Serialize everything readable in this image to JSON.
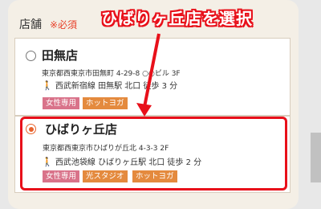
{
  "form": {
    "section_title": "店舗",
    "required_label": "※必須"
  },
  "stores": [
    {
      "name": "田無店",
      "address": "東京都西東京市田無町 4-29-8 ○○ビル 3F",
      "access": "西武新宿線 田無駅 北口 徒歩 3 分",
      "tags": [
        "女性専用",
        "ホットヨガ"
      ],
      "selected": false
    },
    {
      "name": "ひばりヶ丘店",
      "address": "東京都西東京市ひばりが丘北 4-3-3 2F",
      "access": "西武池袋線 ひばりヶ丘駅 北口 徒歩 2 分",
      "tags": [
        "女性専用",
        "光スタジオ",
        "ホットヨガ"
      ],
      "selected": true
    }
  ],
  "annotation": {
    "label": "ひばりヶ丘店を選択",
    "color": "#e8101a"
  },
  "colors": {
    "accent": "#e8622c",
    "tag_pink": "#d9738a",
    "tag_orange": "#e48a3e",
    "required": "#e8412a"
  },
  "icons": {
    "walk": "walking-person-icon"
  }
}
